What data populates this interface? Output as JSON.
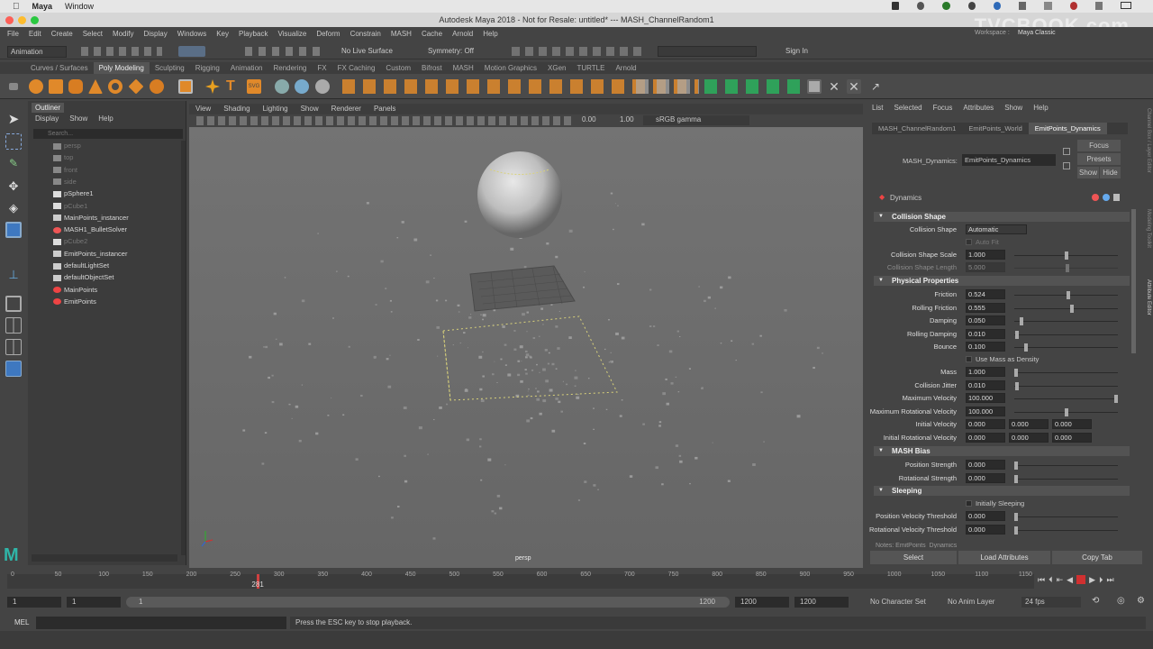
{
  "mac": {
    "app": "Maya",
    "menu": [
      "Window"
    ]
  },
  "window": {
    "title": "Autodesk Maya 2018 - Not for Resale: untitled*   ---   MASH_ChannelRandom1"
  },
  "watermark": "TVCBOOK.com",
  "menubar": [
    "File",
    "Edit",
    "Create",
    "Select",
    "Modify",
    "Display",
    "Windows",
    "Key",
    "Playback",
    "Visualize",
    "Deform",
    "Constrain",
    "MASH",
    "Cache",
    "Arnold",
    "Help"
  ],
  "status": {
    "mode": "Animation",
    "live": "No Live Surface",
    "symmetry": "Symmetry: Off",
    "sign_in": "Sign In",
    "workspace_label": "Workspace :",
    "workspace": "Maya Classic"
  },
  "shelf_tabs": [
    "Curves / Surfaces",
    "Poly Modeling",
    "Sculpting",
    "Rigging",
    "Animation",
    "Rendering",
    "FX",
    "FX Caching",
    "Custom",
    "Bifrost",
    "MASH",
    "Motion Graphics",
    "XGen",
    "TURTLE",
    "Arnold"
  ],
  "shelf_active": "Poly Modeling",
  "outliner": {
    "title": "Outliner",
    "menu": [
      "Display",
      "Show",
      "Help"
    ],
    "search": "Search...",
    "items": [
      {
        "name": "persp",
        "dim": true,
        "icon": "camera-icon"
      },
      {
        "name": "top",
        "dim": true,
        "icon": "camera-icon"
      },
      {
        "name": "front",
        "dim": true,
        "icon": "camera-icon"
      },
      {
        "name": "side",
        "dim": true,
        "icon": "camera-icon"
      },
      {
        "name": "pSphere1",
        "dim": false,
        "icon": "mesh-icon"
      },
      {
        "name": "pCube1",
        "dim": true,
        "icon": "mesh-icon"
      },
      {
        "name": "MainPoints_instancer",
        "dim": false,
        "icon": "instancer-icon"
      },
      {
        "name": "MASH1_BulletSolver",
        "dim": false,
        "icon": "solver-icon"
      },
      {
        "name": "pCube2",
        "dim": true,
        "icon": "mesh-icon"
      },
      {
        "name": "EmitPoints_instancer",
        "dim": false,
        "icon": "instancer-icon"
      },
      {
        "name": "defaultLightSet",
        "dim": false,
        "icon": "set-icon"
      },
      {
        "name": "defaultObjectSet",
        "dim": false,
        "icon": "set-icon"
      },
      {
        "name": "MainPoints",
        "dim": false,
        "icon": "mash-icon"
      },
      {
        "name": "EmitPoints",
        "dim": false,
        "icon": "mash-icon"
      }
    ]
  },
  "viewport": {
    "menu": [
      "View",
      "Shading",
      "Lighting",
      "Show",
      "Renderer",
      "Panels"
    ],
    "exposure": "0.00",
    "gamma": "1.00",
    "colorspace": "sRGB gamma",
    "camera": "persp"
  },
  "attr": {
    "menu": [
      "List",
      "Selected",
      "Focus",
      "Attributes",
      "Show",
      "Help"
    ],
    "tabs": [
      "MASH_ChannelRandom1",
      "EmitPoints_World",
      "EmitPoints_Dynamics"
    ],
    "active_tab": "EmitPoints_Dynamics",
    "node_label": "MASH_Dynamics:",
    "node_value": "EmitPoints_Dynamics",
    "buttons": {
      "focus": "Focus",
      "presets": "Presets",
      "show": "Show",
      "hide": "Hide"
    },
    "panel_title": "Dynamics",
    "sections": {
      "collision": "Collision Shape",
      "physical": "Physical Properties",
      "bias": "MASH Bias",
      "sleeping": "Sleeping"
    },
    "collision_shape": {
      "label": "Collision Shape",
      "value": "Automatic"
    },
    "auto_fit": "Auto Fit",
    "collision_scale": {
      "label": "Collision Shape Scale",
      "value": "1.000",
      "knob": 0.5
    },
    "collision_length": {
      "label": "Collision Shape Length",
      "value": "5.000"
    },
    "physical": [
      {
        "label": "Friction",
        "value": "0.524",
        "knob": 0.52
      },
      {
        "label": "Rolling Friction",
        "value": "0.555",
        "knob": 0.555
      },
      {
        "label": "Damping",
        "value": "0.050",
        "knob": 0.05
      },
      {
        "label": "Rolling Damping",
        "value": "0.010",
        "knob": 0.01
      },
      {
        "label": "Bounce",
        "value": "0.100",
        "knob": 0.1
      }
    ],
    "use_mass_density": "Use Mass as Density",
    "physical2": [
      {
        "label": "Mass",
        "value": "1.000",
        "knob": 0.0
      },
      {
        "label": "Collision Jitter",
        "value": "0.010",
        "knob": 0.01
      },
      {
        "label": "Maximum Velocity",
        "value": "100.000",
        "knob": 1.0
      },
      {
        "label": "Maximum Rotational Velocity",
        "value": "100.000",
        "knob": 0.5
      }
    ],
    "initial_velocity": {
      "label": "Initial Velocity",
      "values": [
        "0.000",
        "0.000",
        "0.000"
      ]
    },
    "initial_rot_velocity": {
      "label": "Initial Rotational Velocity",
      "values": [
        "0.000",
        "0.000",
        "0.000"
      ]
    },
    "bias": [
      {
        "label": "Position Strength",
        "value": "0.000",
        "knob": 0.0
      },
      {
        "label": "Rotational Strength",
        "value": "0.000",
        "knob": 0.0
      }
    ],
    "initially_sleeping": "Initially Sleeping",
    "sleeping": [
      {
        "label": "Position Velocity Threshold",
        "value": "0.000",
        "knob": 0.0
      },
      {
        "label": "Rotational Velocity Threshold",
        "value": "0.000",
        "knob": 0.0
      }
    ],
    "notes": "Notes: EmitPoints_Dynamics",
    "bottom_buttons": {
      "select": "Select",
      "load": "Load Attributes",
      "copy": "Copy Tab"
    },
    "side_tabs": [
      "Channel Box / Layer Editor",
      "Modeling Toolkit",
      "Attribute Editor"
    ]
  },
  "timeline": {
    "ticks": [
      "0",
      "50",
      "100",
      "150",
      "200",
      "250",
      "300",
      "350",
      "400",
      "450",
      "500",
      "550",
      "600",
      "650",
      "700",
      "750",
      "800",
      "850",
      "900",
      "950",
      "1000",
      "1050",
      "1100",
      "1150"
    ],
    "current": "281",
    "current_frac": 0.2342
  },
  "range": {
    "start": "1",
    "start2": "1",
    "range_start": "1",
    "range_end": "1200",
    "end": "1200",
    "end2": "1200",
    "char_set": "No Character Set",
    "anim_layer": "No Anim Layer",
    "fps": "24 fps"
  },
  "cmd": {
    "label": "MEL",
    "help": "Press the ESC key to stop playback."
  }
}
